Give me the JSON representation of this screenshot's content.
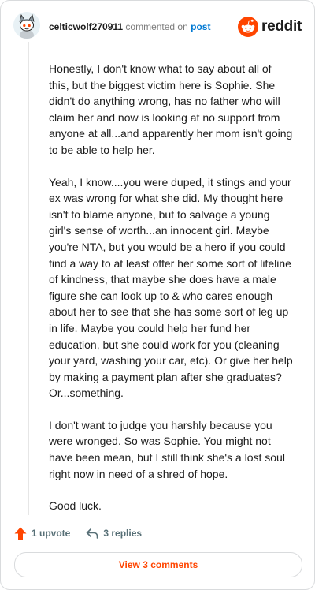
{
  "header": {
    "username": "celticwolf270911",
    "verb": "commented on",
    "post_link": "post",
    "brand": "reddit"
  },
  "comment": {
    "paragraphs": [
      "Honestly, I don't know what to say about all of this, but the biggest victim here is Sophie. She didn't do anything wrong, has no father who will claim her and now is looking at no support from anyone at all...and apparently her mom isn't going to be able to help her.",
      "Yeah, I know....you were duped, it stings and your ex was wrong for what she did. My thought here isn't to blame anyone, but to salvage a young girl's sense of worth...an innocent girl. Maybe you're NTA, but you would be a hero if you could find a way to at least offer her some sort of lifeline of kindness, that maybe she does have a male figure she can look up to & who cares enough about her to see that she has some sort of leg up in life. Maybe you could help her fund her education, but she could work for you (cleaning your yard, washing your car, etc). Or give her help by making a payment plan after she graduates? Or...something.",
      "I don't want to judge you harshly because you were wronged. So was Sophie. You might not have been mean, but I still think she's a lost soul right now in need of a shred of hope.",
      "Good luck."
    ]
  },
  "actions": {
    "upvote_label": "1 upvote",
    "replies_label": "3 replies"
  },
  "footer": {
    "view_comments_label": "View 3 comments"
  },
  "colors": {
    "reddit_orange": "#ff4500",
    "link_blue": "#0079d3",
    "muted": "#576f76"
  },
  "icons": {
    "avatar": "snoo-avatar-icon",
    "brand": "reddit-logo-icon",
    "upvote": "upvote-arrow-icon",
    "reply": "reply-arrow-icon"
  }
}
